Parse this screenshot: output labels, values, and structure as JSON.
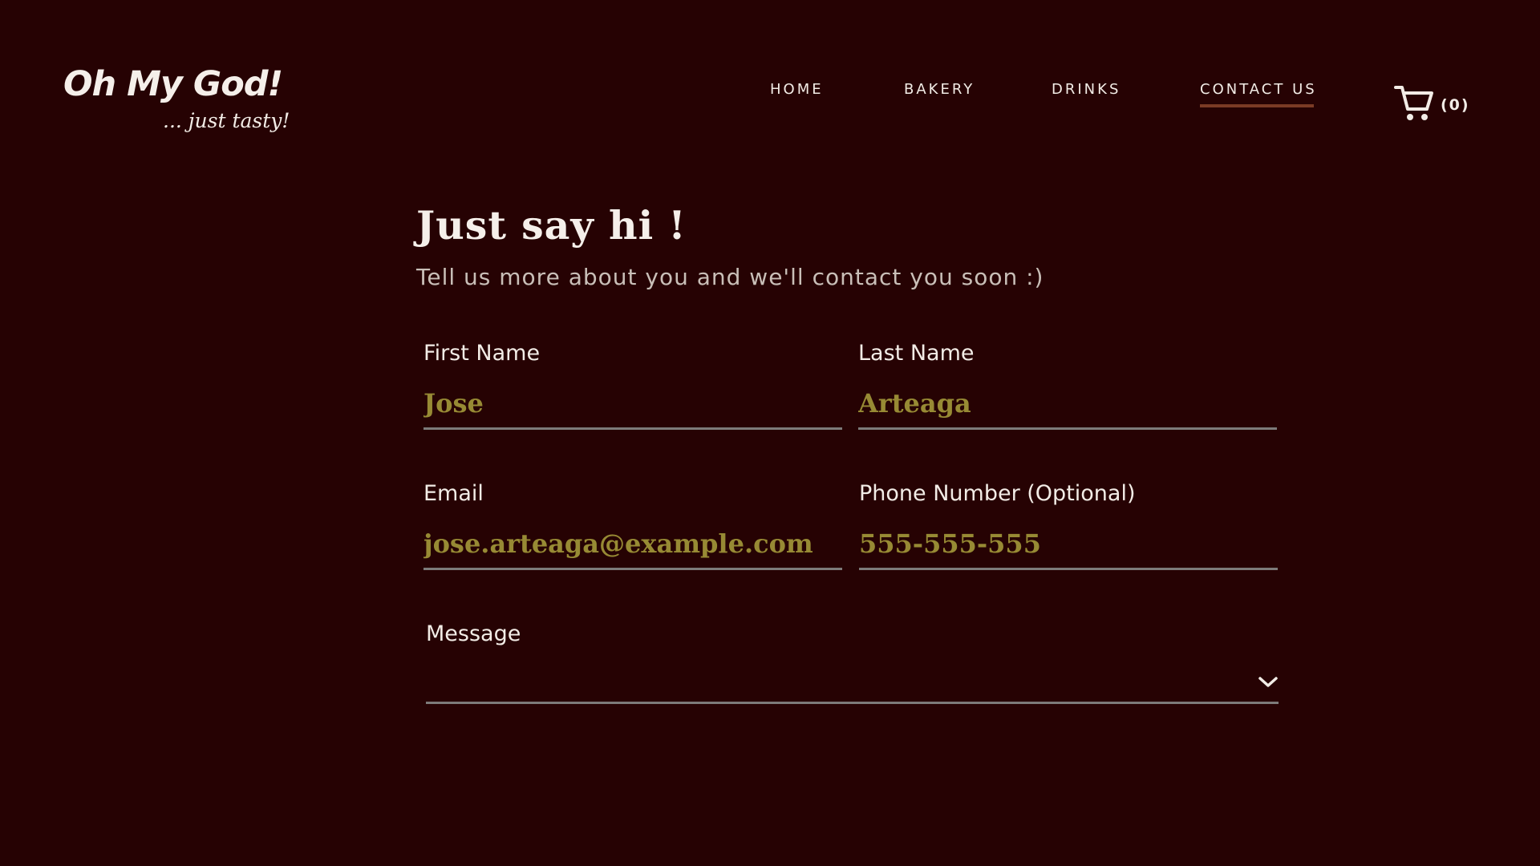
{
  "brand": {
    "title": "Oh My God!",
    "tagline": "... just tasty!"
  },
  "nav": {
    "items": [
      {
        "label": "HOME"
      },
      {
        "label": "BAKERY"
      },
      {
        "label": "DRINKS"
      },
      {
        "label": "CONTACT US",
        "active": true
      }
    ]
  },
  "cart": {
    "icon": "shopping-cart-icon",
    "count_label": "(0)"
  },
  "contact": {
    "heading": "Just say hi !",
    "subheading": "Tell us more about you and we'll contact you soon :)",
    "fields": {
      "first_name": {
        "label": "First Name",
        "value": "Jose"
      },
      "last_name": {
        "label": "Last Name",
        "value": "Arteaga"
      },
      "email": {
        "label": "Email",
        "value": "jose.arteaga@example.com"
      },
      "phone": {
        "label": "Phone Number (Optional)",
        "value": "555-555-555"
      },
      "message": {
        "label": "Message",
        "value": "",
        "icon": "chevron-down-icon"
      }
    }
  },
  "colors": {
    "background": "#260203",
    "text": "#f2ece6",
    "input_value": "#978a34",
    "underline": "#7d7b7a",
    "nav_active_underline": "#7a3b25"
  }
}
